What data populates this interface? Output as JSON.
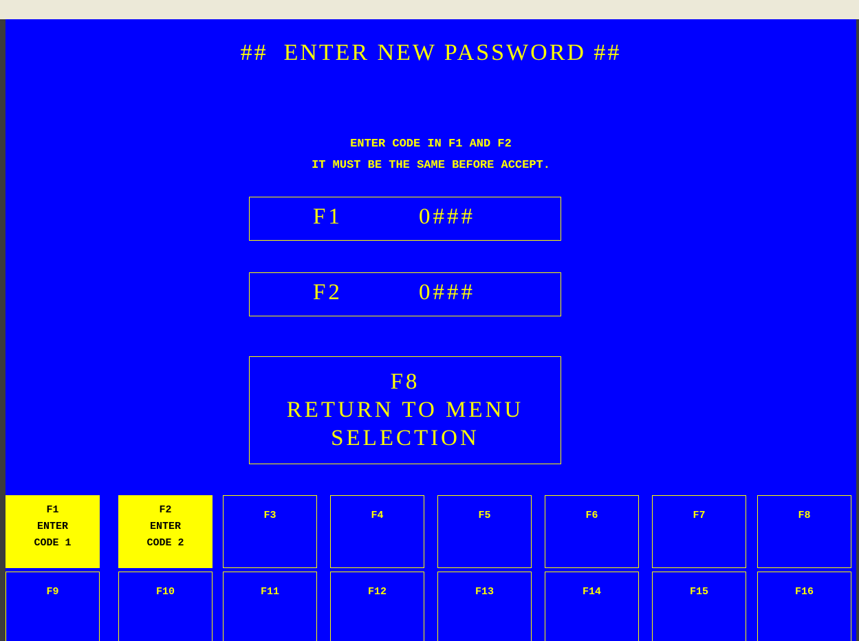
{
  "screen": {
    "title": "##  ENTER NEW PASSWORD ##",
    "instruction_line1": "ENTER CODE IN F1 AND F2",
    "instruction_line2": "IT MUST BE THE SAME BEFORE ACCEPT."
  },
  "fields": [
    {
      "label": "F1",
      "value": "0###"
    },
    {
      "label": "F2",
      "value": "0###"
    }
  ],
  "return_box": {
    "key": "F8",
    "line1": "RETURN TO MENU",
    "line2": "SELECTION"
  },
  "function_keys": [
    {
      "key": "F1",
      "line1": "ENTER",
      "line2": "CODE 1",
      "active": true
    },
    {
      "key": "F2",
      "line1": "ENTER",
      "line2": "CODE 2",
      "active": true
    },
    {
      "key": "F3"
    },
    {
      "key": "F4"
    },
    {
      "key": "F5"
    },
    {
      "key": "F6"
    },
    {
      "key": "F7"
    },
    {
      "key": "F8"
    },
    {
      "key": "F9"
    },
    {
      "key": "F10"
    },
    {
      "key": "F11"
    },
    {
      "key": "F12"
    },
    {
      "key": "F13"
    },
    {
      "key": "F14"
    },
    {
      "key": "F15"
    },
    {
      "key": "F16"
    }
  ],
  "colors": {
    "screen_background": "#0000ff",
    "text": "#ffff00",
    "active_key_background": "#ffff00",
    "active_key_text": "#000000"
  }
}
